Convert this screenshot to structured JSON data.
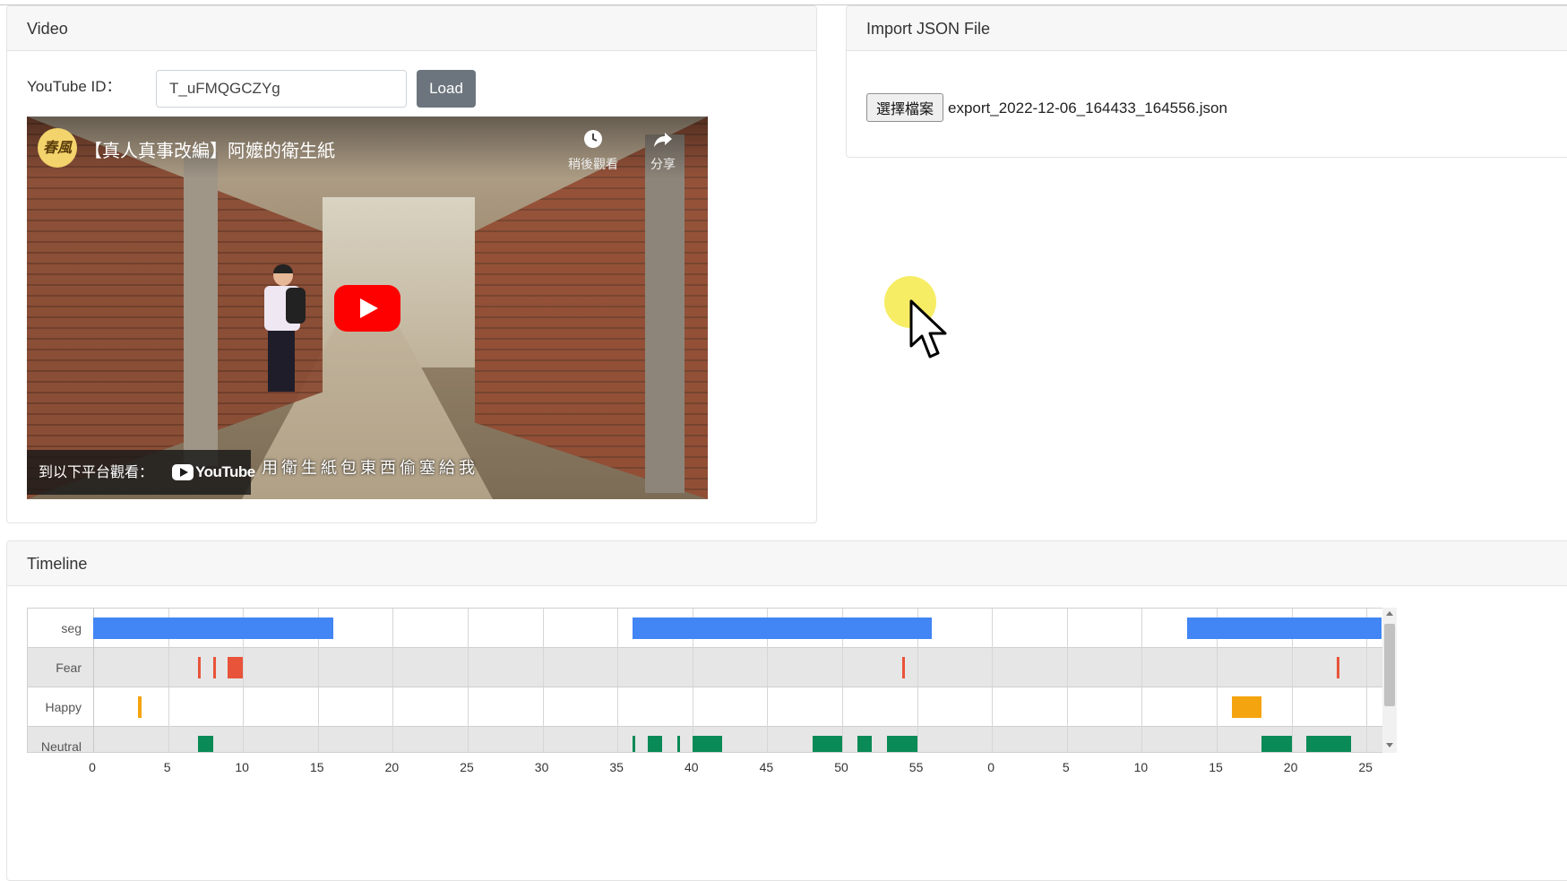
{
  "video_card": {
    "title": "Video",
    "youtube_label": "YouTube ID：",
    "youtube_id_value": "T_uFMQGCZYg",
    "load_label": "Load",
    "player": {
      "channel_logo_text": "春風",
      "video_title": "【真人真事改編】阿嬤的衛生紙",
      "watch_later_label": "稍後觀看",
      "share_label": "分享",
      "watch_on_label": "到以下平台觀看：",
      "youtube_brand": "YouTube",
      "subtitle": "用衛生紙包東西偷塞給我"
    }
  },
  "import_card": {
    "title": "Import JSON File",
    "choose_file_label": "選擇檔案",
    "file_name": "export_2022-12-06_164433_164556.json"
  },
  "timeline_card": {
    "title": "Timeline",
    "rows": [
      "seg",
      "Fear",
      "Happy",
      "Neutral"
    ],
    "tick_labels": [
      "0",
      "5",
      "10",
      "15",
      "20",
      "25",
      "30",
      "35",
      "40",
      "45",
      "50",
      "55",
      "0",
      "5",
      "10",
      "15",
      "20",
      "25"
    ],
    "colors": {
      "seg": "#4285f4",
      "Fear": "#e8543a",
      "Happy": "#f4a40e",
      "Neutral": "#0a8a56"
    },
    "segments": {
      "seg": [
        [
          0.0,
          16.0
        ],
        [
          36.0,
          56.0
        ],
        [
          73.0,
          86.0
        ]
      ],
      "Fear": [
        [
          7.0,
          7.2
        ],
        [
          8.0,
          8.2
        ],
        [
          9.0,
          10.0
        ],
        [
          54.0,
          54.2
        ],
        [
          83.0,
          83.2
        ]
      ],
      "Happy": [
        [
          3.0,
          3.2
        ],
        [
          76.0,
          78.0
        ]
      ],
      "Neutral": [
        [
          7.0,
          8.0
        ],
        [
          36.0,
          36.2
        ],
        [
          37.0,
          38.0
        ],
        [
          39.0,
          39.2
        ],
        [
          40.0,
          42.0
        ],
        [
          48.0,
          50.0
        ],
        [
          51.0,
          52.0
        ],
        [
          53.0,
          55.0
        ],
        [
          78.0,
          80.0
        ],
        [
          81.0,
          84.0
        ]
      ]
    }
  }
}
